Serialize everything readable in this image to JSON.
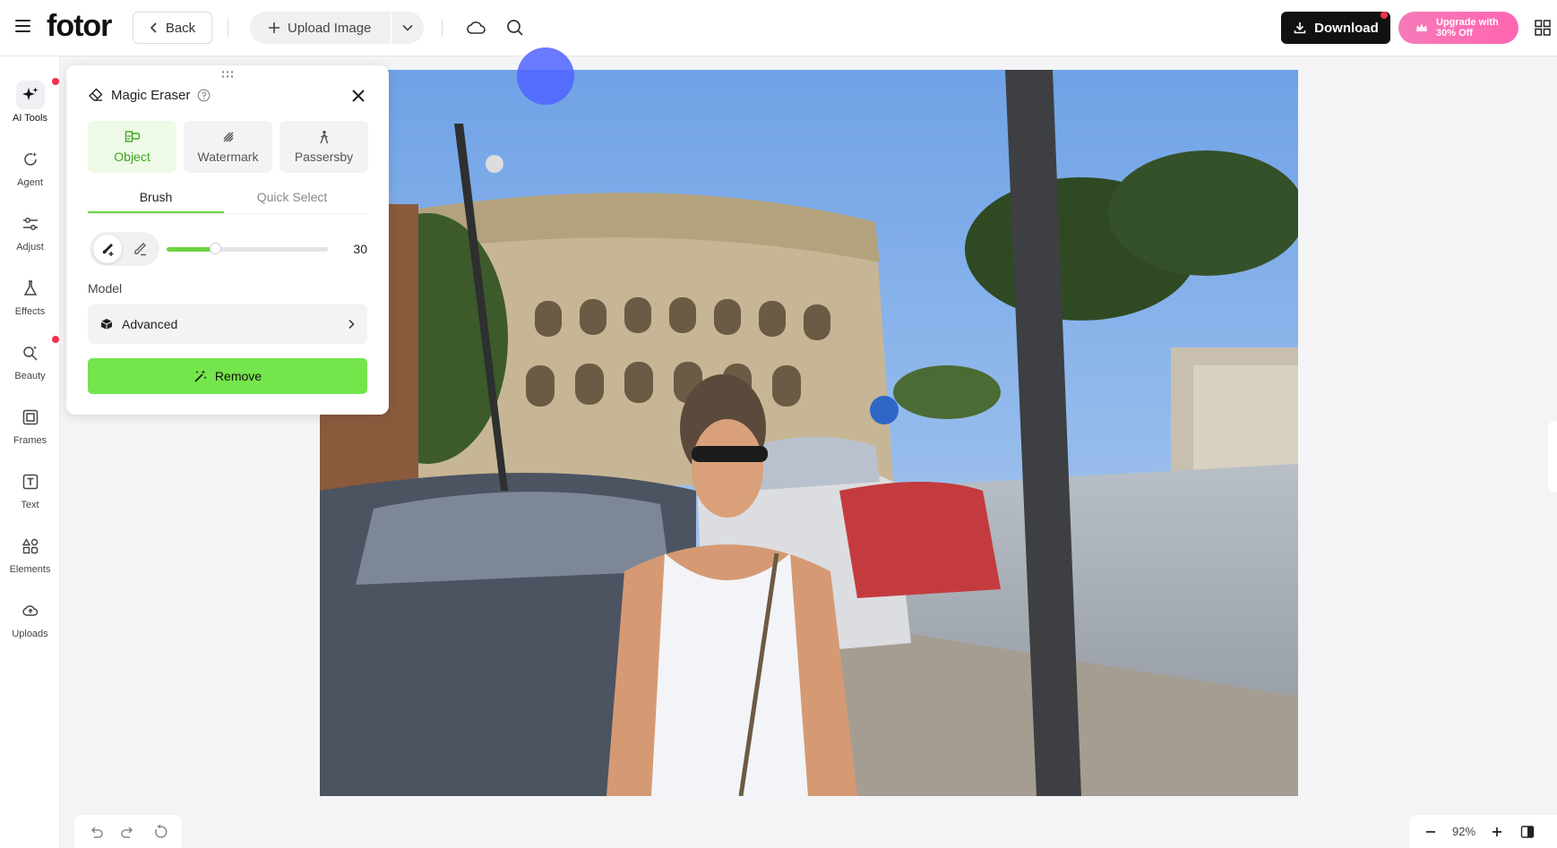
{
  "header": {
    "logo": "fotor",
    "back_label": "Back",
    "upload_label": "Upload Image",
    "download_label": "Download",
    "upgrade_line1": "Upgrade with",
    "upgrade_line2": "30% Off"
  },
  "sidebar": {
    "items": [
      {
        "label": "AI Tools",
        "icon": "sparkle-icon"
      },
      {
        "label": "Agent",
        "icon": "agent-icon"
      },
      {
        "label": "Adjust",
        "icon": "sliders-icon"
      },
      {
        "label": "Effects",
        "icon": "flask-icon"
      },
      {
        "label": "Beauty",
        "icon": "beauty-icon"
      },
      {
        "label": "Frames",
        "icon": "frame-icon"
      },
      {
        "label": "Text",
        "icon": "text-icon"
      },
      {
        "label": "Elements",
        "icon": "shapes-icon"
      },
      {
        "label": "Uploads",
        "icon": "cloud-upload-icon"
      }
    ]
  },
  "panel": {
    "title": "Magic Eraser",
    "modes": [
      {
        "label": "Object"
      },
      {
        "label": "Watermark"
      },
      {
        "label": "Passersby"
      }
    ],
    "tabs": [
      {
        "label": "Brush"
      },
      {
        "label": "Quick Select"
      }
    ],
    "brush_size": "30",
    "brush_size_fraction": 0.3,
    "model_label": "Model",
    "model_value": "Advanced",
    "remove_label": "Remove"
  },
  "zoom": {
    "value": "92%"
  },
  "colors": {
    "accent_green": "#75e54c",
    "active_green_text": "#3fa51e",
    "download_bg": "#111111",
    "upgrade_pink": "#ff66b0",
    "brush_cursor": "#5064ff"
  }
}
